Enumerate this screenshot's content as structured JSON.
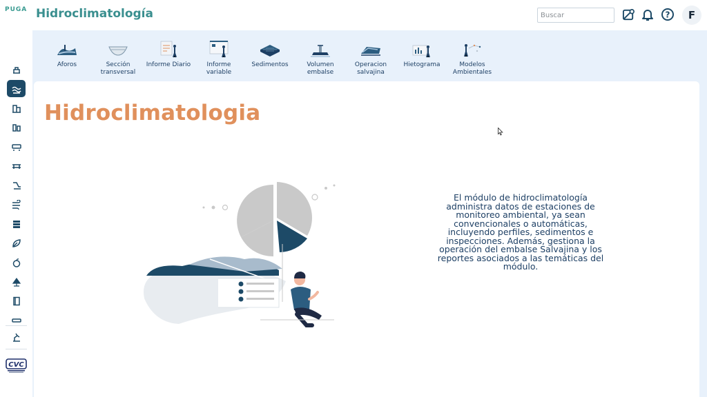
{
  "header": {
    "logo_text": "PUGA",
    "app_title": "Hidroclimatología",
    "search_placeholder": "Buscar",
    "user_initial": "F",
    "icons": [
      "map-alert-icon",
      "bell-icon",
      "help-icon"
    ]
  },
  "sidebar": {
    "active_index": 1,
    "items": [
      "dam-icon",
      "water-icon",
      "building-icon",
      "tank-icon",
      "rail-icon",
      "bridge-icon",
      "river-icon",
      "wind-icon",
      "layers-icon",
      "leaf-icon",
      "apple-icon",
      "tree-icon",
      "book-icon",
      "bus-icon",
      "crane-icon"
    ],
    "partner_logo_text": "CVC"
  },
  "modules": [
    {
      "label": "Aforos",
      "icon": "aforos-icon"
    },
    {
      "label": "Sección\ntransversal",
      "icon": "section-icon"
    },
    {
      "label": "Informe Diario",
      "icon": "daily-report-icon"
    },
    {
      "label": "Informe\nvariable",
      "icon": "variable-report-icon"
    },
    {
      "label": "Sedimentos",
      "icon": "sediments-icon"
    },
    {
      "label": "Volumen\nembalse",
      "icon": "reservoir-volume-icon"
    },
    {
      "label": "Operacion\nsalvajina",
      "icon": "salvajina-icon"
    },
    {
      "label": "Hietograma",
      "icon": "hietogram-icon"
    },
    {
      "label": "Modelos\nAmbientales",
      "icon": "env-models-icon"
    }
  ],
  "main": {
    "title": "Hidroclimatologia",
    "description": "El módulo de hidroclimatología administra datos de estaciones de monitoreo ambiental, ya sean convencionales o automáticas, incluyendo perfiles, sedimentos e inspecciones. Además, gestiona la operación del embalse Salvajina y los reportes asociados a las temáticas del módulo."
  },
  "colors": {
    "accent": "#3a8f8f",
    "title_orange": "#e0905c",
    "navy": "#1d4a67",
    "background": "#e8f1fb"
  }
}
